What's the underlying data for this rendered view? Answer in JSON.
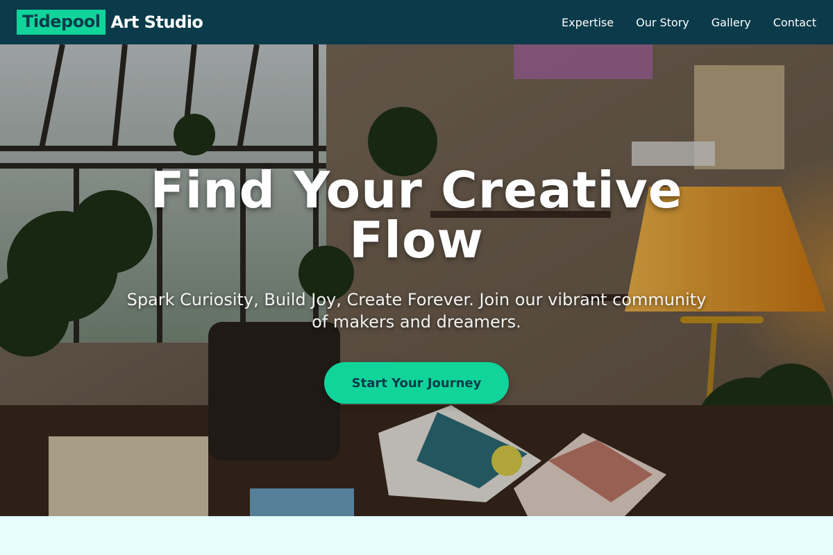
{
  "brand": {
    "highlight": "Tidepool",
    "rest": "Art Studio",
    "accent_color": "#10d49a",
    "nav_color": "#0b3b4a"
  },
  "nav": {
    "items": [
      {
        "label": "Expertise"
      },
      {
        "label": "Our Story"
      },
      {
        "label": "Gallery"
      },
      {
        "label": "Contact"
      }
    ]
  },
  "hero": {
    "title": "Find Your Creative Flow",
    "subtitle": "Spark Curiosity, Build Joy, Create Forever. Join our vibrant community of makers and dreamers.",
    "cta_label": "Start Your Journey",
    "background_image": "art studio interior with plants, lamp and sketchbooks"
  },
  "section_below": {
    "background_color": "#e6fdfc"
  }
}
